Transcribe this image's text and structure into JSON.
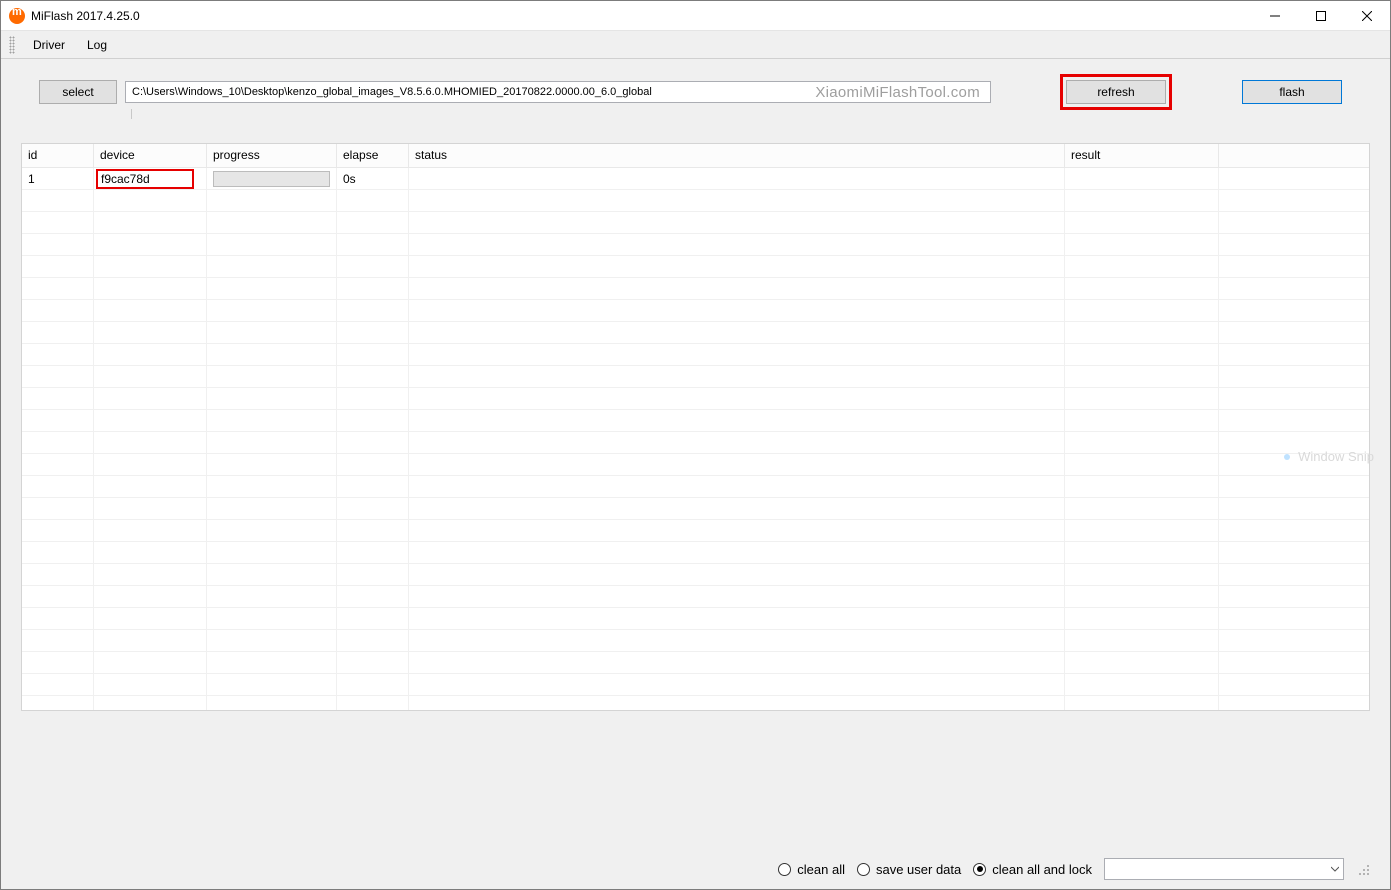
{
  "window": {
    "title": "MiFlash 2017.4.25.0"
  },
  "menubar": {
    "items": [
      "Driver",
      "Log"
    ]
  },
  "toolbar": {
    "select_label": "select",
    "path_value": "C:\\Users\\Windows_10\\Desktop\\kenzo_global_images_V8.5.6.0.MHOMIED_20170822.0000.00_6.0_global",
    "watermark": "XiaomiMiFlashTool.com",
    "refresh_label": "refresh",
    "flash_label": "flash"
  },
  "table": {
    "columns": [
      "id",
      "device",
      "progress",
      "elapse",
      "status",
      "result",
      ""
    ],
    "rows": [
      {
        "id": "1",
        "device": "f9cac78d",
        "progress": "",
        "elapse": "0s",
        "status": "",
        "result": ""
      }
    ],
    "empty_row_count": 24
  },
  "overlay": {
    "window_snip": "Window Snip"
  },
  "bottombar": {
    "options": [
      {
        "label": "clean all",
        "checked": false
      },
      {
        "label": "save user data",
        "checked": false
      },
      {
        "label": "clean all and lock",
        "checked": true
      }
    ],
    "combo_value": ""
  }
}
